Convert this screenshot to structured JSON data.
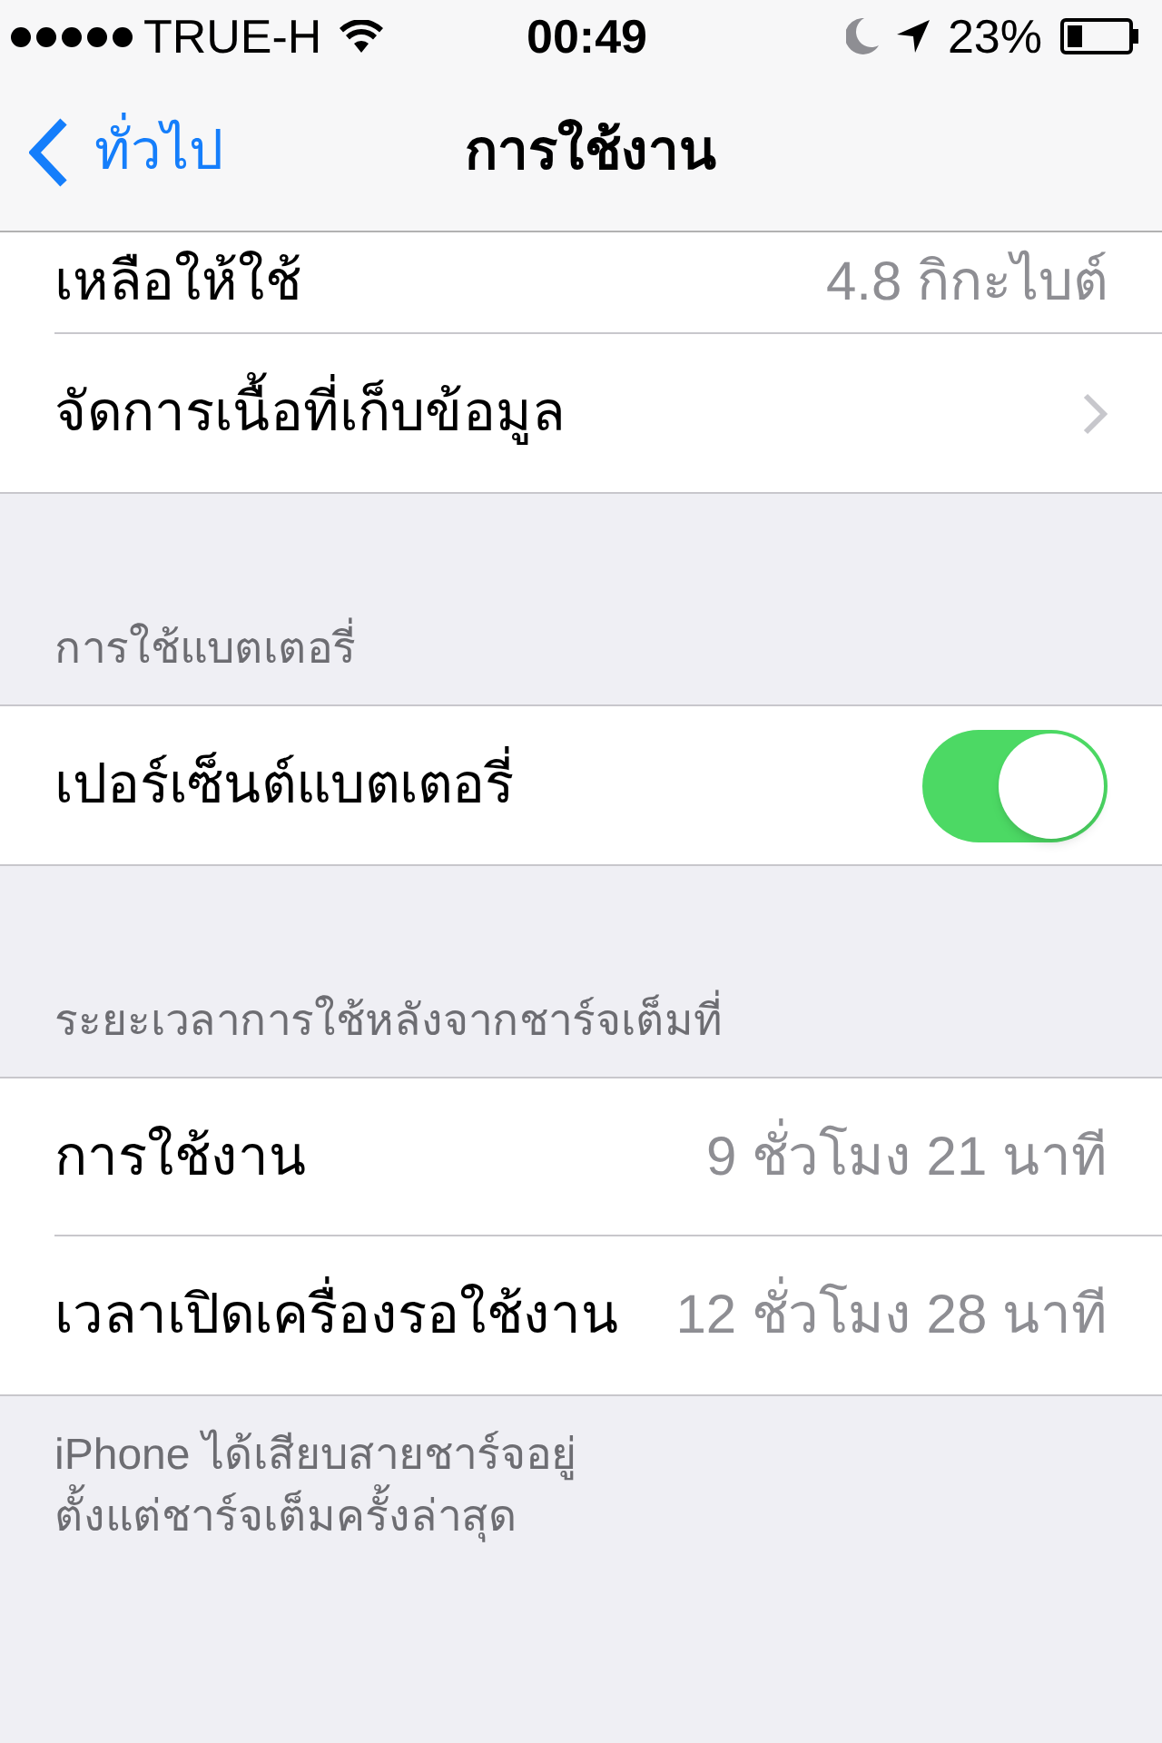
{
  "status_bar": {
    "signal_dots": [
      {
        "on": true
      },
      {
        "on": true
      },
      {
        "on": true
      },
      {
        "on": true
      },
      {
        "on": true
      }
    ],
    "carrier": "TRUE-H",
    "time": "00:49",
    "battery_percent": "23%"
  },
  "nav": {
    "back": "ทั่วไป",
    "title": "การใช้งาน"
  },
  "sections": [
    {
      "rows": [
        {
          "kind": "value",
          "label": "เหลือให้ใช้",
          "value": "4.8 กิกะไบต์"
        },
        {
          "kind": "link",
          "label": "จัดการเนื้อที่เก็บข้อมูล"
        }
      ]
    },
    {
      "header": "การใช้แบตเตอรี่",
      "rows": [
        {
          "kind": "toggle",
          "label": "เปอร์เซ็นต์แบตเตอรี่",
          "on": true
        }
      ]
    },
    {
      "header": "ระยะเวลาการใช้หลังจากชาร์จเต็มที่",
      "rows": [
        {
          "kind": "value",
          "label": "การใช้งาน",
          "value": "9 ชั่วโมง 21 นาที"
        },
        {
          "kind": "value",
          "label": "เวลาเปิดเครื่องรอใช้งาน",
          "value": "12 ชั่วโมง 28 นาที"
        }
      ],
      "footer": [
        "iPhone ได้เสียบสายชาร์จอยู่",
        "ตั้งแต่ชาร์จเต็มครั้งล่าสุด"
      ]
    }
  ]
}
